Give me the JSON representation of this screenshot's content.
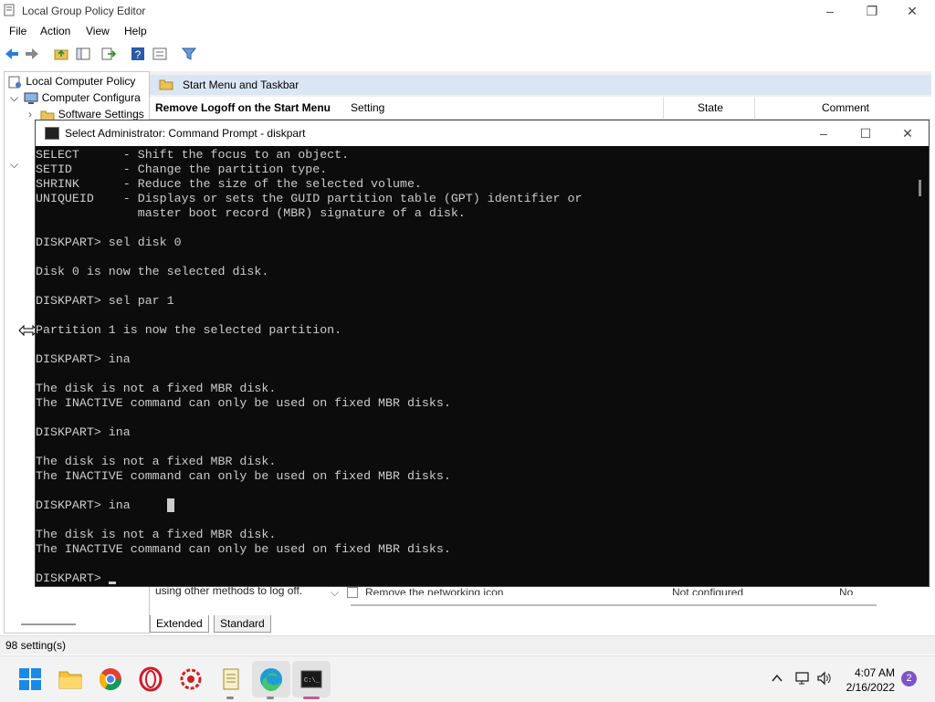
{
  "gpe": {
    "title": "Local Group Policy Editor",
    "menus": [
      "File",
      "Action",
      "View",
      "Help"
    ],
    "tree": {
      "root": "Local Computer Policy",
      "computer_config": "Computer Configura",
      "software_settings": "Software Settings"
    },
    "folder": "Start Menu and Taskbar",
    "selected_policy": "Remove Logoff on the Start Menu",
    "columns": {
      "setting": "Setting",
      "state": "State",
      "comment": "Comment"
    },
    "description_snippet": "using other methods to log off.",
    "partial_row": {
      "setting": "Remove the networking icon",
      "state": "Not configured",
      "comment": "No"
    },
    "tabs": [
      "Extended",
      "Standard"
    ],
    "status": "98 setting(s)"
  },
  "cmd": {
    "title": "Select Administrator: Command Prompt - diskpart",
    "lines": [
      "SELECT      - Shift the focus to an object.",
      "SETID       - Change the partition type.",
      "SHRINK      - Reduce the size of the selected volume.",
      "UNIQUEID    - Displays or sets the GUID partition table (GPT) identifier or",
      "              master boot record (MBR) signature of a disk.",
      "",
      "DISKPART> sel disk 0",
      "",
      "Disk 0 is now the selected disk.",
      "",
      "DISKPART> sel par 1",
      "",
      "Partition 1 is now the selected partition.",
      "",
      "DISKPART> ina",
      "",
      "The disk is not a fixed MBR disk.",
      "The INACTIVE command can only be used on fixed MBR disks.",
      "",
      "DISKPART> ina",
      "",
      "The disk is not a fixed MBR disk.",
      "The INACTIVE command can only be used on fixed MBR disks.",
      "",
      "DISKPART> ina",
      "",
      "The disk is not a fixed MBR disk.",
      "The INACTIVE command can only be used on fixed MBR disks.",
      "",
      "DISKPART> "
    ]
  },
  "taskbar": {
    "time": "4:07 AM",
    "date": "2/16/2022",
    "notification_count": "2",
    "apps": [
      "start-icon",
      "file-explorer-icon",
      "chrome-icon",
      "opera-icon",
      "settings-app-icon",
      "notepad-icon",
      "edge-icon",
      "terminal-icon"
    ]
  },
  "colors": {
    "cmd_bg": "#0c0c0c",
    "cmd_text": "#cccccc",
    "accent": "#0078d4",
    "notification": "#7b57c4"
  }
}
